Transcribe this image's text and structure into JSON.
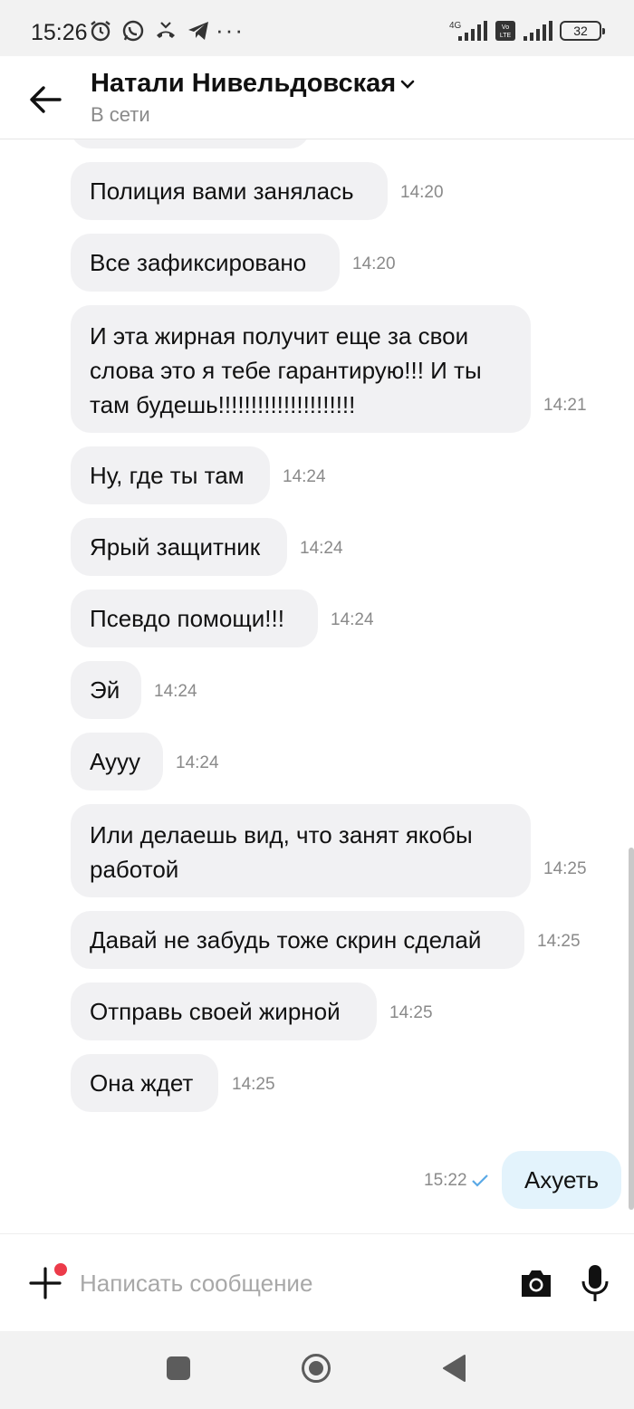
{
  "status_bar": {
    "time": "15:26",
    "more": "···",
    "battery": "32",
    "network": "4G",
    "volte": "VoLTE"
  },
  "header": {
    "contact_name": "Натали Нивельдовская",
    "contact_status": "В сети"
  },
  "messages": [
    {
      "text": "Полиция вами занялась",
      "time": "14:20"
    },
    {
      "text": "Все зафиксировано",
      "time": "14:20"
    },
    {
      "text": "И эта жирная получит еще за свои слова это я тебе гарантирую!!! И ты там будешь!!!!!!!!!!!!!!!!!!!!!",
      "time": "14:21"
    },
    {
      "text": "Ну, где ты там",
      "time": "14:24"
    },
    {
      "text": "Ярый защитник",
      "time": "14:24"
    },
    {
      "text": "Псевдо помощи!!!",
      "time": "14:24"
    },
    {
      "text": "Эй",
      "time": "14:24"
    },
    {
      "text": "Аууу",
      "time": "14:24"
    },
    {
      "text": "Или делаешь вид, что занят якобы работой",
      "time": "14:25"
    },
    {
      "text": "Давай не забудь тоже скрин сделай",
      "time": "14:25"
    },
    {
      "text": "Отправь своей жирной",
      "time": "14:25"
    },
    {
      "text": "Она ждет",
      "time": "14:25"
    }
  ],
  "outgoing": {
    "text": "Ахуеть",
    "time": "15:22"
  },
  "composer": {
    "placeholder": "Написать сообщение"
  },
  "icons": {
    "back": "arrow-left-icon",
    "chevron": "chevron-down-icon",
    "plus": "plus-icon",
    "camera": "camera-icon",
    "mic": "microphone-icon",
    "check": "check-icon"
  },
  "colors": {
    "incoming_bubble": "#f1f1f3",
    "outgoing_bubble": "#e3f3fc",
    "notification_dot": "#ec3b4a",
    "check": "#5aa9e6"
  }
}
